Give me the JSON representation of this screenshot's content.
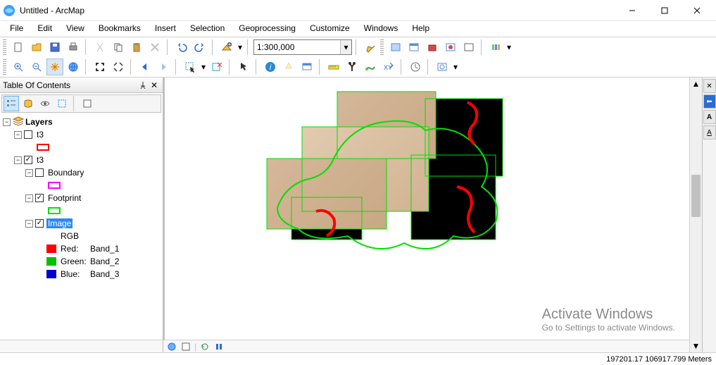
{
  "window": {
    "title": "Untitled - ArcMap"
  },
  "menu": [
    "File",
    "Edit",
    "View",
    "Bookmarks",
    "Insert",
    "Selection",
    "Geoprocessing",
    "Customize",
    "Windows",
    "Help"
  ],
  "scale": "1:300,000",
  "toc": {
    "title": "Table Of Contents",
    "root": "Layers",
    "items": [
      {
        "name": "t3",
        "checked": false
      },
      {
        "name": "t3",
        "checked": true,
        "children": [
          {
            "name": "Boundary",
            "checked": false
          },
          {
            "name": "Footprint",
            "checked": true
          },
          {
            "name": "Image",
            "checked": true,
            "selected": true,
            "rgb_label": "RGB",
            "bands": [
              {
                "label": "Red:",
                "band": "Band_1",
                "color": "#ff0000"
              },
              {
                "label": "Green:",
                "band": "Band_2",
                "color": "#00c000"
              },
              {
                "label": "Blue:",
                "band": "Band_3",
                "color": "#0000d0"
              }
            ]
          }
        ]
      }
    ]
  },
  "watermark": {
    "line1": "Activate Windows",
    "line2": "Go to Settings to activate Windows."
  },
  "status": {
    "coords": "197201.17 106917.799 Meters"
  },
  "right_rail": [
    "✕",
    "⬅",
    "A",
    "A"
  ]
}
